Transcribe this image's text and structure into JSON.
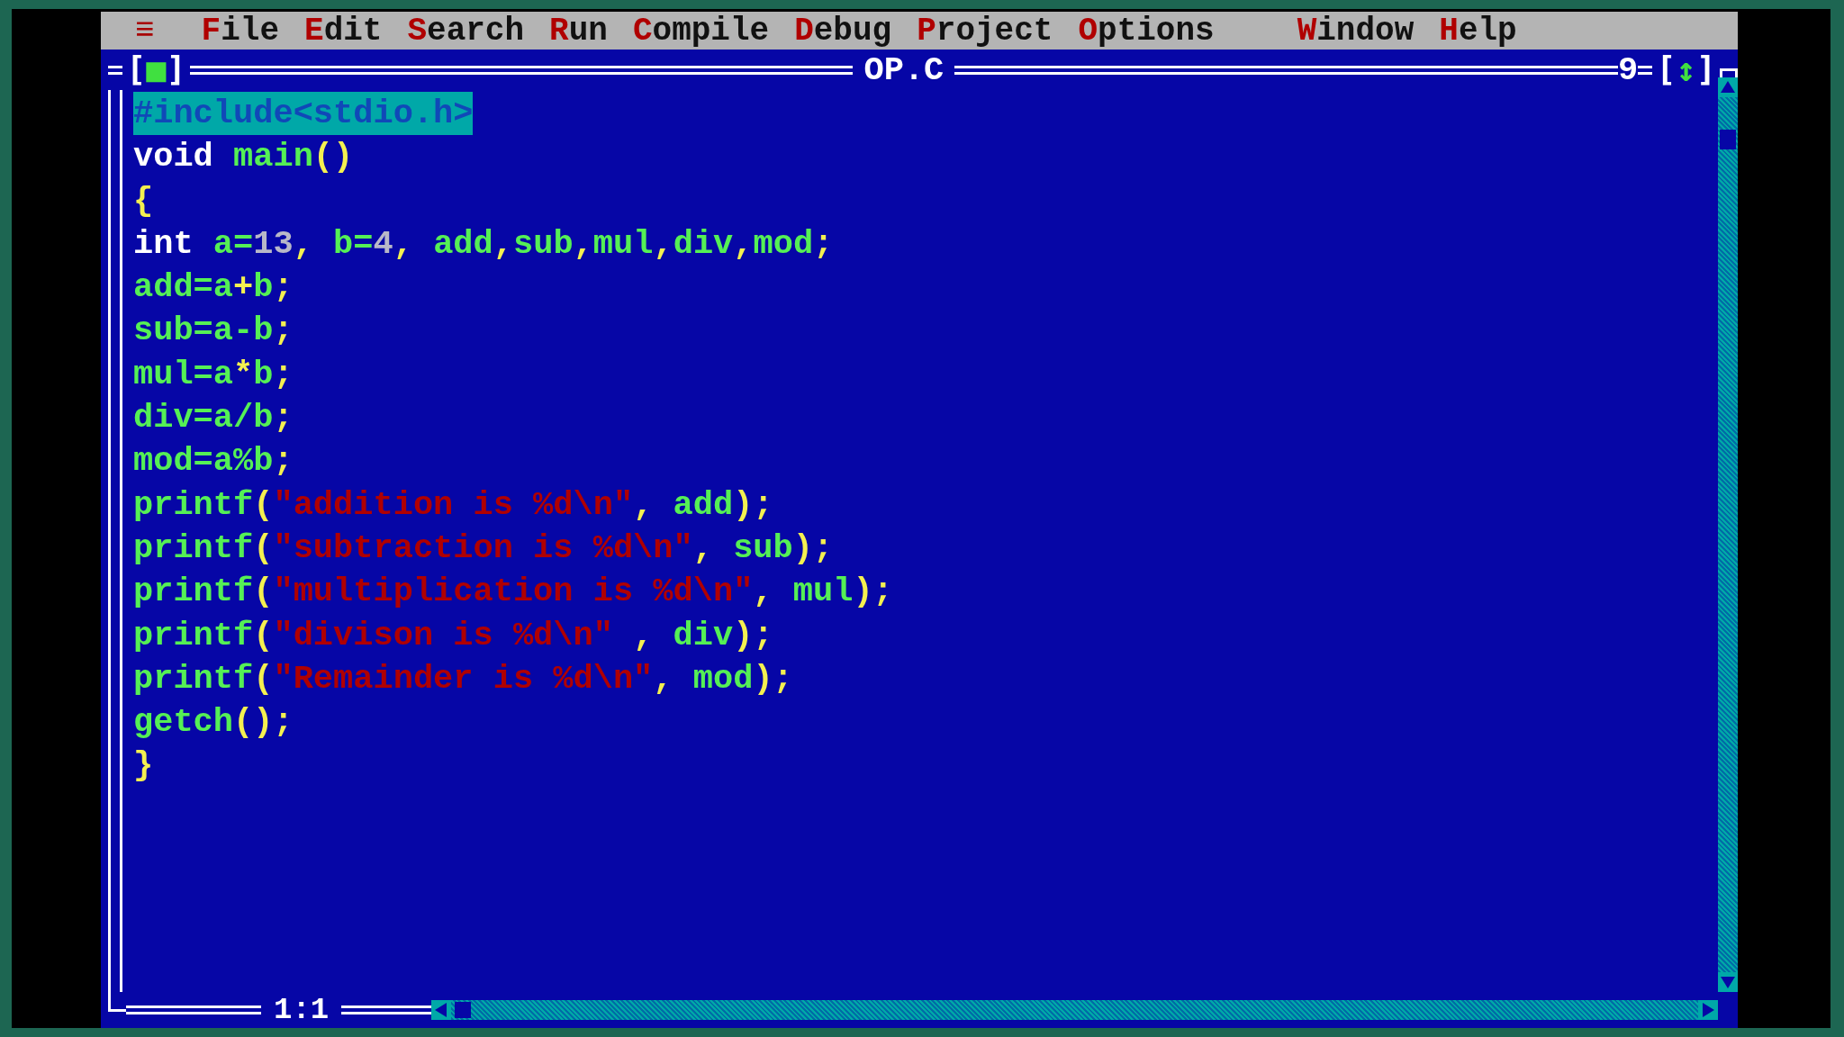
{
  "menu_bar": {
    "system_menu": "≡",
    "items": [
      {
        "label": "File",
        "selected": false
      },
      {
        "label": "Edit",
        "selected": false
      },
      {
        "label": "Search",
        "selected": false
      },
      {
        "label": "Run",
        "selected": false
      },
      {
        "label": "Compile",
        "selected": false
      },
      {
        "label": "Debug",
        "selected": false
      },
      {
        "label": "Project",
        "selected": false
      },
      {
        "label": "Options",
        "selected": false
      },
      {
        "label": "Window",
        "selected": false
      },
      {
        "label": "Help",
        "selected": false
      }
    ]
  },
  "editor": {
    "close_box": "[■]",
    "title": "OP.C",
    "window_number": "9",
    "zoom_box": "[↕]",
    "cursor_position": "1:1",
    "lines": [
      {
        "selected": true,
        "tokens": [
          {
            "text": "#include<stdio.h>",
            "kind": "directive"
          }
        ]
      },
      {
        "selected": false,
        "tokens": [
          {
            "text": "void ",
            "kind": "keyword"
          },
          {
            "text": "main",
            "kind": "ident"
          },
          {
            "text": "()",
            "kind": "symbol"
          }
        ]
      },
      {
        "selected": false,
        "tokens": [
          {
            "text": "{",
            "kind": "symbol"
          }
        ]
      },
      {
        "selected": false,
        "tokens": [
          {
            "text": "int ",
            "kind": "keyword"
          },
          {
            "text": "a=",
            "kind": "ident"
          },
          {
            "text": "13",
            "kind": "number"
          },
          {
            "text": ", ",
            "kind": "symbol"
          },
          {
            "text": "b=",
            "kind": "ident"
          },
          {
            "text": "4",
            "kind": "number"
          },
          {
            "text": ", ",
            "kind": "symbol"
          },
          {
            "text": "add",
            "kind": "ident"
          },
          {
            "text": ",",
            "kind": "symbol"
          },
          {
            "text": "sub",
            "kind": "ident"
          },
          {
            "text": ",",
            "kind": "symbol"
          },
          {
            "text": "mul",
            "kind": "ident"
          },
          {
            "text": ",",
            "kind": "symbol"
          },
          {
            "text": "div",
            "kind": "ident"
          },
          {
            "text": ",",
            "kind": "symbol"
          },
          {
            "text": "mod",
            "kind": "ident"
          },
          {
            "text": ";",
            "kind": "symbol"
          }
        ]
      },
      {
        "selected": false,
        "tokens": [
          {
            "text": "add=a",
            "kind": "ident"
          },
          {
            "text": "+",
            "kind": "symbol"
          },
          {
            "text": "b",
            "kind": "ident"
          },
          {
            "text": ";",
            "kind": "symbol"
          }
        ]
      },
      {
        "selected": false,
        "tokens": [
          {
            "text": "sub=a-b",
            "kind": "ident"
          },
          {
            "text": ";",
            "kind": "symbol"
          }
        ]
      },
      {
        "selected": false,
        "tokens": [
          {
            "text": "mul=a",
            "kind": "ident"
          },
          {
            "text": "*",
            "kind": "symbol"
          },
          {
            "text": "b",
            "kind": "ident"
          },
          {
            "text": ";",
            "kind": "symbol"
          }
        ]
      },
      {
        "selected": false,
        "tokens": [
          {
            "text": "div=a/b",
            "kind": "ident"
          },
          {
            "text": ";",
            "kind": "symbol"
          }
        ]
      },
      {
        "selected": false,
        "tokens": [
          {
            "text": "mod=a%b",
            "kind": "ident"
          },
          {
            "text": ";",
            "kind": "symbol"
          }
        ]
      },
      {
        "selected": false,
        "tokens": [
          {
            "text": "printf",
            "kind": "ident"
          },
          {
            "text": "(",
            "kind": "symbol"
          },
          {
            "text": "\"addition is %d\\n\"",
            "kind": "string"
          },
          {
            "text": ", ",
            "kind": "symbol"
          },
          {
            "text": "add",
            "kind": "ident"
          },
          {
            "text": ");",
            "kind": "symbol"
          }
        ]
      },
      {
        "selected": false,
        "tokens": [
          {
            "text": "printf",
            "kind": "ident"
          },
          {
            "text": "(",
            "kind": "symbol"
          },
          {
            "text": "\"subtraction is %d\\n\"",
            "kind": "string"
          },
          {
            "text": ", ",
            "kind": "symbol"
          },
          {
            "text": "sub",
            "kind": "ident"
          },
          {
            "text": ");",
            "kind": "symbol"
          }
        ]
      },
      {
        "selected": false,
        "tokens": [
          {
            "text": "printf",
            "kind": "ident"
          },
          {
            "text": "(",
            "kind": "symbol"
          },
          {
            "text": "\"multiplication is %d\\n\"",
            "kind": "string"
          },
          {
            "text": ", ",
            "kind": "symbol"
          },
          {
            "text": "mul",
            "kind": "ident"
          },
          {
            "text": ");",
            "kind": "symbol"
          }
        ]
      },
      {
        "selected": false,
        "tokens": [
          {
            "text": "printf",
            "kind": "ident"
          },
          {
            "text": "(",
            "kind": "symbol"
          },
          {
            "text": "\"divison is %d\\n\"",
            "kind": "string"
          },
          {
            "text": " , ",
            "kind": "symbol"
          },
          {
            "text": "div",
            "kind": "ident"
          },
          {
            "text": ");",
            "kind": "symbol"
          }
        ]
      },
      {
        "selected": false,
        "tokens": [
          {
            "text": "printf",
            "kind": "ident"
          },
          {
            "text": "(",
            "kind": "symbol"
          },
          {
            "text": "\"Remainder is %d\\n\"",
            "kind": "string"
          },
          {
            "text": ", ",
            "kind": "symbol"
          },
          {
            "text": "mod",
            "kind": "ident"
          },
          {
            "text": ");",
            "kind": "symbol"
          }
        ]
      },
      {
        "selected": false,
        "tokens": [
          {
            "text": "getch",
            "kind": "ident"
          },
          {
            "text": "();",
            "kind": "symbol"
          }
        ]
      },
      {
        "selected": false,
        "tokens": [
          {
            "text": "}",
            "kind": "symbol"
          }
        ]
      }
    ]
  }
}
